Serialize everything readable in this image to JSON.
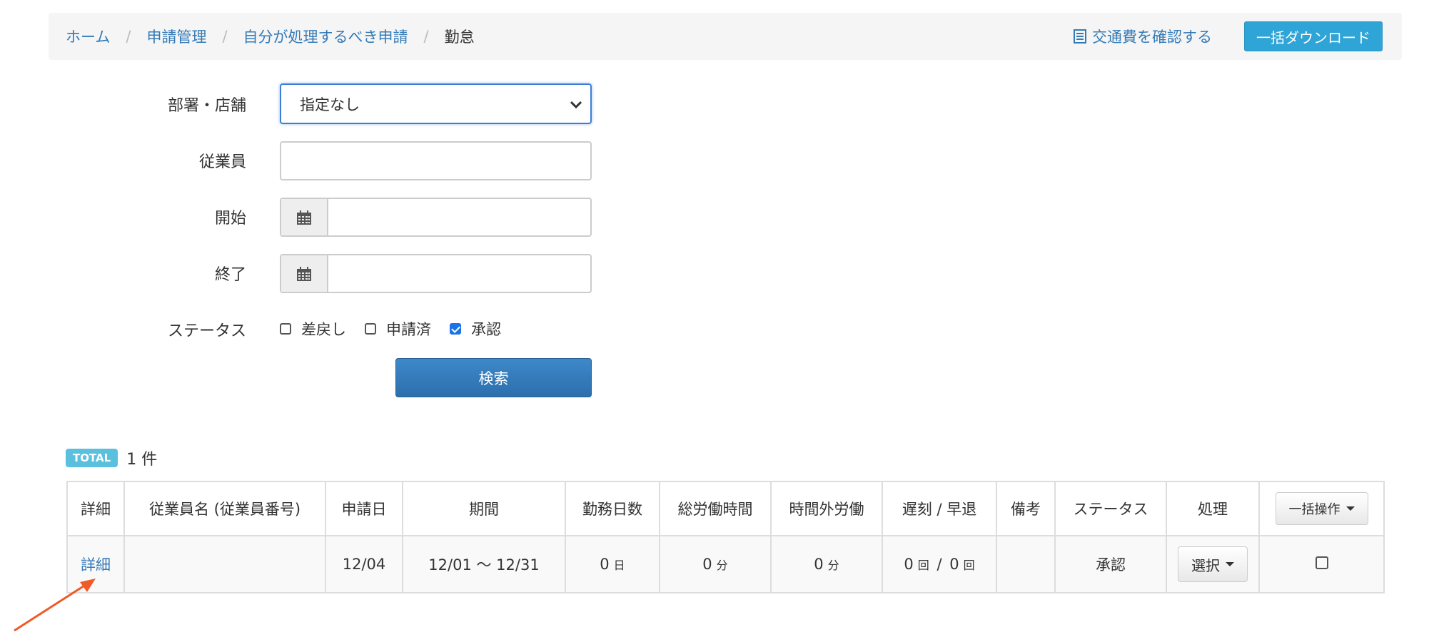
{
  "breadcrumb": {
    "items": [
      "ホーム",
      "申請管理",
      "自分が処理するべき申請"
    ],
    "separator": "/",
    "current": "勤怠"
  },
  "header": {
    "transport_link": "交通費を確認する",
    "download_button": "一括ダウンロード"
  },
  "form": {
    "department_label": "部署・店舗",
    "department_value": "指定なし",
    "employee_label": "従業員",
    "employee_value": "",
    "start_label": "開始",
    "start_value": "",
    "end_label": "終了",
    "end_value": "",
    "status_label": "ステータス",
    "status_options": [
      {
        "label": "差戻し",
        "checked": false
      },
      {
        "label": "申請済",
        "checked": false
      },
      {
        "label": "承認",
        "checked": true
      }
    ],
    "search_button": "検索"
  },
  "results": {
    "total_badge": "TOTAL",
    "total_count": "1 件",
    "columns": [
      "詳細",
      "従業員名 (従業員番号)",
      "申請日",
      "期間",
      "勤務日数",
      "総労働時間",
      "時間外労働",
      "遅刻 / 早退",
      "備考",
      "ステータス",
      "処理"
    ],
    "bulk_button": "一括操作",
    "rows": [
      {
        "detail": "詳細",
        "employee": "",
        "date": "12/04",
        "period": "12/01 〜 12/31",
        "work_days": "0",
        "work_days_unit": "日",
        "total_hours": "0",
        "total_hours_unit": "分",
        "overtime": "0",
        "overtime_unit": "分",
        "late_count": "0",
        "late_unit": "回",
        "late_sep": "/",
        "early_count": "0",
        "early_unit": "回",
        "note": "",
        "status": "承認",
        "action": "選択"
      }
    ]
  },
  "colors": {
    "link": "#337ab7",
    "download_button": "#2fa4d7",
    "search_button": "#337ab7",
    "badge": "#5bc0de",
    "annotation_arrow": "#f05a28"
  }
}
